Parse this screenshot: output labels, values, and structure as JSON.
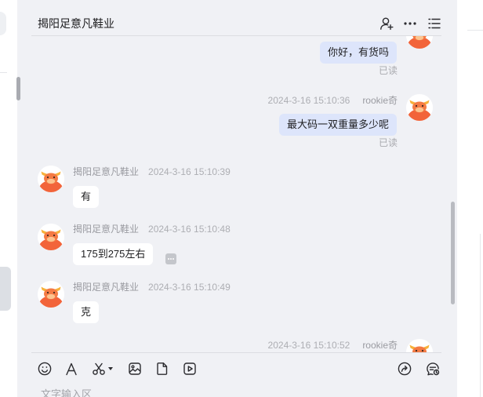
{
  "chat": {
    "title": "揭阳足意凡鞋业",
    "header_icons": [
      "add-contact-icon",
      "more-icon",
      "list-icon"
    ]
  },
  "messages": [
    {
      "outgoing": true,
      "text": "你好，有货吗",
      "status": "已读"
    },
    {
      "outgoing": true,
      "sender": "rookie奇",
      "time": "2024-3-16 15:10:36",
      "text": "最大码一双重量多少呢",
      "status": "已读"
    },
    {
      "outgoing": false,
      "sender": "揭阳足意凡鞋业",
      "time": "2024-3-16 15:10:39",
      "text": "有"
    },
    {
      "outgoing": false,
      "sender": "揭阳足意凡鞋业",
      "time": "2024-3-16 15:10:48",
      "text": "175到275左右"
    },
    {
      "outgoing": false,
      "sender": "揭阳足意凡鞋业",
      "time": "2024-3-16 15:10:49",
      "text": "克"
    },
    {
      "outgoing": true,
      "sender": "rookie奇",
      "time": "2024-3-16 15:10:52"
    }
  ],
  "toolbar": {
    "left_icons": [
      "emoji-icon",
      "font-icon",
      "scissors-icon",
      "caret-down-icon",
      "image-icon",
      "file-icon",
      "video-icon"
    ],
    "right_icons": [
      "forward-icon",
      "chat-history-icon"
    ]
  },
  "composer": {
    "placeholder": "文字输入区"
  },
  "colors": {
    "chat_background": "#f0f1f5",
    "own_bubble": "#dde5fb",
    "other_bubble": "#ffffff",
    "avatar_orange": "#f2643a"
  }
}
